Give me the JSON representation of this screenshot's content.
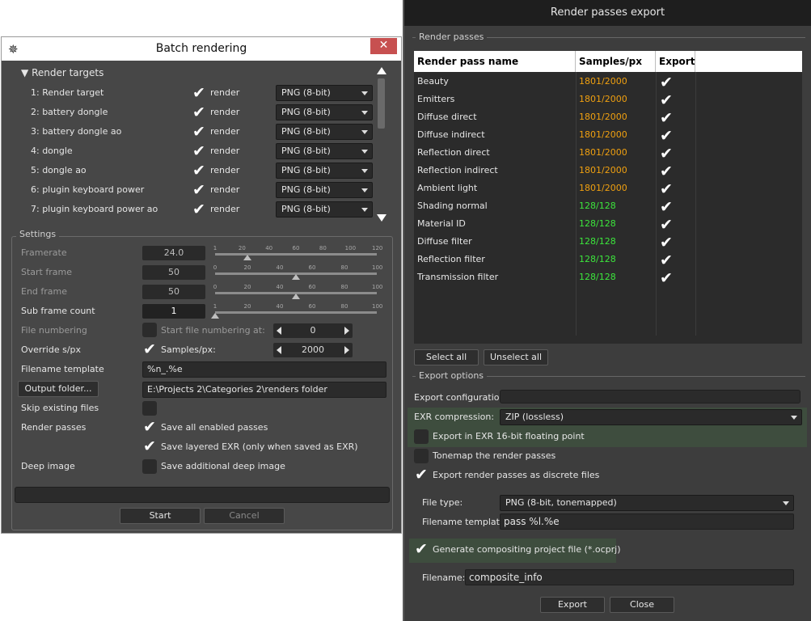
{
  "batch": {
    "title": "Batch rendering",
    "render_targets_label": "Render targets",
    "targets": [
      {
        "label": "1: Render target",
        "render": "render",
        "format": "PNG (8-bit)"
      },
      {
        "label": "2: battery dongle",
        "render": "render",
        "format": "PNG (8-bit)"
      },
      {
        "label": "3: battery dongle ao",
        "render": "render",
        "format": "PNG (8-bit)"
      },
      {
        "label": "4: dongle",
        "render": "render",
        "format": "PNG (8-bit)"
      },
      {
        "label": "5: dongle ao",
        "render": "render",
        "format": "PNG (8-bit)"
      },
      {
        "label": "6: plugin keyboard power",
        "render": "render",
        "format": "PNG (8-bit)"
      },
      {
        "label": "7: plugin keyboard power ao",
        "render": "render",
        "format": "PNG (8-bit)"
      }
    ],
    "settings_label": "Settings",
    "framerate": {
      "label": "Framerate",
      "value": "24.0",
      "fraction": 0.2,
      "ticks": [
        "1",
        "20",
        "40",
        "60",
        "80",
        "100",
        "120"
      ]
    },
    "start_frame": {
      "label": "Start frame",
      "value": "50",
      "fraction": 0.5,
      "ticks": [
        "0",
        "20",
        "40",
        "60",
        "80",
        "100"
      ]
    },
    "end_frame": {
      "label": "End frame",
      "value": "50",
      "fraction": 0.5,
      "ticks": [
        "0",
        "20",
        "40",
        "60",
        "80",
        "100"
      ]
    },
    "sub_frame": {
      "label": "Sub frame count",
      "value": "1",
      "fraction": 0.0,
      "ticks": [
        "1",
        "20",
        "40",
        "60",
        "80",
        "100"
      ]
    },
    "file_numbering": {
      "label": "File numbering",
      "option": "Start file numbering at:",
      "value": "0"
    },
    "override": {
      "label": "Override s/px",
      "option": "Samples/px:",
      "value": "2000"
    },
    "filename_template": {
      "label": "Filename template",
      "value": "%n_.%e"
    },
    "output_folder": {
      "button": "Output folder...",
      "value": "E:\\Projects 2\\Categories 2\\renders folder"
    },
    "skip_existing": {
      "label": "Skip existing files"
    },
    "render_passes": {
      "label": "Render passes",
      "option1": "Save all enabled passes",
      "option2": "Save layered EXR (only when saved as EXR)"
    },
    "deep_image": {
      "label": "Deep image",
      "option": "Save additional deep image"
    },
    "start_button": "Start",
    "cancel_button": "Cancel"
  },
  "passes": {
    "title": "Render passes export",
    "group_label": "Render passes",
    "columns": {
      "name": "Render pass name",
      "samples": "Samples/px",
      "export": "Export"
    },
    "rows": [
      {
        "name": "Beauty",
        "samples": "1801/2000",
        "color": "#f0a010"
      },
      {
        "name": "Emitters",
        "samples": "1801/2000",
        "color": "#f0a010"
      },
      {
        "name": "Diffuse direct",
        "samples": "1801/2000",
        "color": "#f0a010"
      },
      {
        "name": "Diffuse indirect",
        "samples": "1801/2000",
        "color": "#f0a010"
      },
      {
        "name": "Reflection direct",
        "samples": "1801/2000",
        "color": "#f0a010"
      },
      {
        "name": "Reflection indirect",
        "samples": "1801/2000",
        "color": "#f0a010"
      },
      {
        "name": "Ambient light",
        "samples": "1801/2000",
        "color": "#f0a010"
      },
      {
        "name": "Shading normal",
        "samples": "128/128",
        "color": "#3ce63c"
      },
      {
        "name": "Material ID",
        "samples": "128/128",
        "color": "#3ce63c"
      },
      {
        "name": "Diffuse filter",
        "samples": "128/128",
        "color": "#3ce63c"
      },
      {
        "name": "Reflection filter",
        "samples": "128/128",
        "color": "#3ce63c"
      },
      {
        "name": "Transmission filter",
        "samples": "128/128",
        "color": "#3ce63c"
      }
    ],
    "select_all": "Select all",
    "unselect_all": "Unselect all",
    "export_options_label": "Export options",
    "export_config_label": "Export configuration:",
    "exr_compression_label": "EXR compression:",
    "exr_compression_value": "ZIP (lossless)",
    "exr16": "Export in EXR 16-bit floating point",
    "tonemap": "Tonemap the render passes",
    "discrete": "Export render passes as discrete files",
    "file_type_label": "File type:",
    "file_type_value": "PNG (8-bit, tonemapped)",
    "filename_template_label": "Filename template:",
    "filename_template_value": "pass %l.%e",
    "compositing": "Generate compositing project file (*.ocprj)",
    "filename_label": "Filename:",
    "filename_value": "composite_info",
    "export_button": "Export",
    "close_button": "Close"
  }
}
